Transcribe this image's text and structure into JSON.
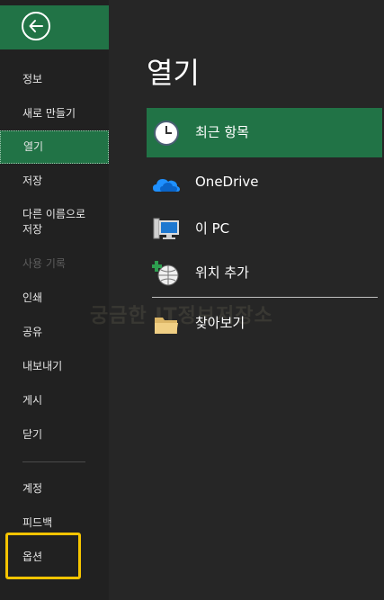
{
  "sidebar": {
    "items": [
      {
        "label": "정보"
      },
      {
        "label": "새로 만들기"
      },
      {
        "label": "열기"
      },
      {
        "label": "저장"
      },
      {
        "label": "다른 이름으로\n저장"
      },
      {
        "label": "사용 기록"
      },
      {
        "label": "인쇄"
      },
      {
        "label": "공유"
      },
      {
        "label": "내보내기"
      },
      {
        "label": "게시"
      },
      {
        "label": "닫기"
      },
      {
        "label": "계정"
      },
      {
        "label": "피드백"
      },
      {
        "label": "옵션"
      }
    ]
  },
  "main": {
    "title": "열기",
    "locations": [
      {
        "label": "최근 항목",
        "icon": "clock-icon"
      },
      {
        "label": "OneDrive",
        "icon": "onedrive-cloud-icon"
      },
      {
        "label": "이 PC",
        "icon": "computer-icon"
      },
      {
        "label": "위치 추가",
        "icon": "add-location-globe-icon"
      },
      {
        "label": "찾아보기",
        "icon": "folder-icon"
      }
    ]
  },
  "watermark": "궁금한 IT정보저장소",
  "colors": {
    "accent": "#217346",
    "highlight": "#f5c400",
    "sidebar_bg": "#212121",
    "main_bg": "#262626"
  }
}
